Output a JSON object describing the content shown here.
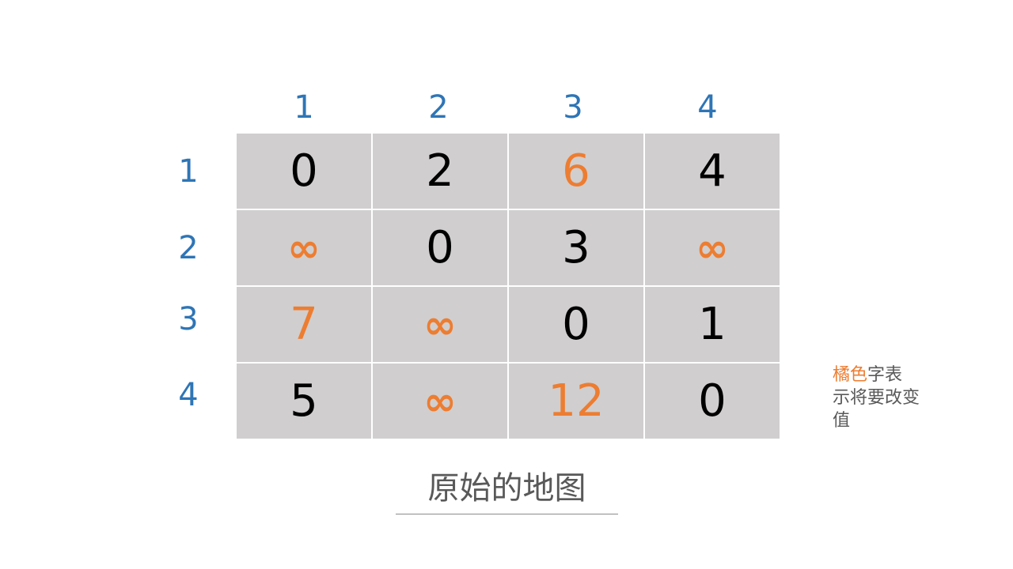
{
  "columns": [
    "1",
    "2",
    "3",
    "4"
  ],
  "rows": [
    "1",
    "2",
    "3",
    "4"
  ],
  "matrix": [
    [
      {
        "v": "0",
        "changed": false
      },
      {
        "v": "2",
        "changed": false
      },
      {
        "v": "6",
        "changed": true
      },
      {
        "v": "4",
        "changed": false
      }
    ],
    [
      {
        "v": "∞",
        "changed": true
      },
      {
        "v": "0",
        "changed": false
      },
      {
        "v": "3",
        "changed": false
      },
      {
        "v": "∞",
        "changed": true
      }
    ],
    [
      {
        "v": "7",
        "changed": true
      },
      {
        "v": "∞",
        "changed": true
      },
      {
        "v": "0",
        "changed": false
      },
      {
        "v": "1",
        "changed": false
      }
    ],
    [
      {
        "v": "5",
        "changed": false
      },
      {
        "v": "∞",
        "changed": true
      },
      {
        "v": "12",
        "changed": true
      },
      {
        "v": "0",
        "changed": false
      }
    ]
  ],
  "caption": "原始的地图",
  "note": {
    "accent_text": "橘色",
    "rest_text": "字表示将要改变值"
  },
  "colors": {
    "header": "#2e75b6",
    "changed": "#ed7d31",
    "cell_bg": "#d0cece",
    "normal": "#000000"
  }
}
